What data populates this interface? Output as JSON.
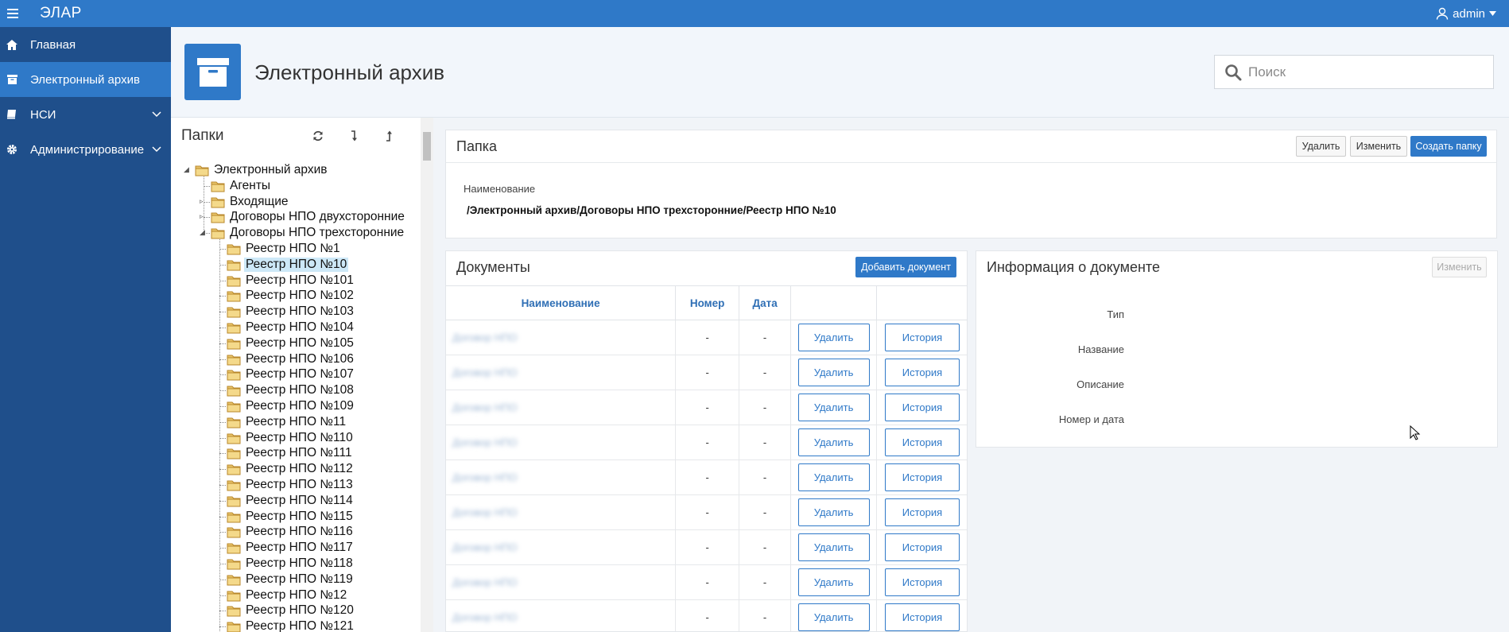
{
  "topbar": {
    "app_title": "ЭЛАР",
    "user_name": "admin"
  },
  "sidebar": {
    "items": [
      {
        "label": "Главная",
        "icon": "home-icon",
        "active": false
      },
      {
        "label": "Электронный архив",
        "icon": "archive-icon",
        "active": true
      },
      {
        "label": "НСИ",
        "icon": "book-icon",
        "active": false,
        "has_submenu": true
      },
      {
        "label": "Администрирование",
        "icon": "gear-icon",
        "active": false,
        "has_submenu": true
      }
    ]
  },
  "header": {
    "title": "Электронный архив",
    "search_placeholder": "Поиск"
  },
  "folders": {
    "title": "Папки",
    "tree": [
      {
        "label": "Электронный архив",
        "level": 0
      },
      {
        "label": "Агенты",
        "level": 1
      },
      {
        "label": "Входящие",
        "level": 1
      },
      {
        "label": "Договоры НПО двухсторонние",
        "level": 1
      },
      {
        "label": "Договоры НПО трехсторонние",
        "level": 1
      },
      {
        "label": "Реестр НПО №1",
        "level": 2
      },
      {
        "label": "Реестр НПО №10",
        "level": 2,
        "selected": true
      },
      {
        "label": "Реестр НПО №101",
        "level": 2
      },
      {
        "label": "Реестр НПО №102",
        "level": 2
      },
      {
        "label": "Реестр НПО №103",
        "level": 2
      },
      {
        "label": "Реестр НПО №104",
        "level": 2
      },
      {
        "label": "Реестр НПО №105",
        "level": 2
      },
      {
        "label": "Реестр НПО №106",
        "level": 2
      },
      {
        "label": "Реестр НПО №107",
        "level": 2
      },
      {
        "label": "Реестр НПО №108",
        "level": 2
      },
      {
        "label": "Реестр НПО №109",
        "level": 2
      },
      {
        "label": "Реестр НПО №11",
        "level": 2
      },
      {
        "label": "Реестр НПО №110",
        "level": 2
      },
      {
        "label": "Реестр НПО №111",
        "level": 2
      },
      {
        "label": "Реестр НПО №112",
        "level": 2
      },
      {
        "label": "Реестр НПО №113",
        "level": 2
      },
      {
        "label": "Реестр НПО №114",
        "level": 2
      },
      {
        "label": "Реестр НПО №115",
        "level": 2
      },
      {
        "label": "Реестр НПО №116",
        "level": 2
      },
      {
        "label": "Реестр НПО №117",
        "level": 2
      },
      {
        "label": "Реестр НПО №118",
        "level": 2
      },
      {
        "label": "Реестр НПО №119",
        "level": 2
      },
      {
        "label": "Реестр НПО №12",
        "level": 2
      },
      {
        "label": "Реестр НПО №120",
        "level": 2
      },
      {
        "label": "Реестр НПО №121",
        "level": 2
      }
    ]
  },
  "folder_card": {
    "title": "Папка",
    "delete_label": "Удалить",
    "edit_label": "Изменить",
    "create_label": "Создать папку",
    "name_label": "Наименование",
    "name_value": "/Электронный архив/Договоры НПО трехсторонние/Реестр НПО №10"
  },
  "documents": {
    "title": "Документы",
    "add_label": "Добавить документ",
    "columns": [
      "Наименование",
      "Номер",
      "Дата",
      "",
      ""
    ],
    "rows": [
      {
        "name": "Договор НПО",
        "number": "-",
        "date": "-",
        "delete": "Удалить",
        "history": "История"
      },
      {
        "name": "Договор НПО",
        "number": "-",
        "date": "-",
        "delete": "Удалить",
        "history": "История"
      },
      {
        "name": "Договор НПО",
        "number": "-",
        "date": "-",
        "delete": "Удалить",
        "history": "История"
      },
      {
        "name": "Договор НПО",
        "number": "-",
        "date": "-",
        "delete": "Удалить",
        "history": "История"
      },
      {
        "name": "Договор НПО",
        "number": "-",
        "date": "-",
        "delete": "Удалить",
        "history": "История"
      },
      {
        "name": "Договор НПО",
        "number": "-",
        "date": "-",
        "delete": "Удалить",
        "history": "История"
      },
      {
        "name": "Договор НПО",
        "number": "-",
        "date": "-",
        "delete": "Удалить",
        "history": "История"
      },
      {
        "name": "Договор НПО",
        "number": "-",
        "date": "-",
        "delete": "Удалить",
        "history": "История"
      },
      {
        "name": "Договор НПО",
        "number": "-",
        "date": "-",
        "delete": "Удалить",
        "history": "История"
      }
    ]
  },
  "doc_info": {
    "title": "Информация о документе",
    "edit_label": "Изменить",
    "fields": [
      "Тип",
      "Название",
      "Описание",
      "Номер и дата"
    ]
  },
  "colors": {
    "accent": "#2f79c8",
    "sidebar": "#1f4f8b",
    "selection": "#cde8f7"
  }
}
